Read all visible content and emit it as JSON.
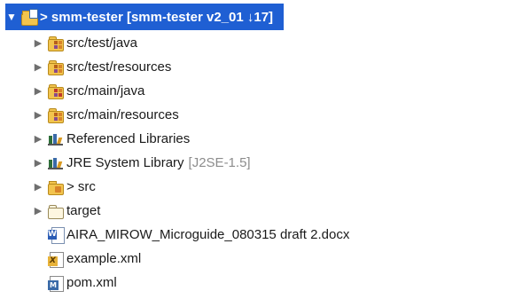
{
  "tree": {
    "root": {
      "twisty": "▼",
      "label": "> smm-tester [smm-tester v2_01 ↓17]",
      "icon": "java-project-icon"
    },
    "items": [
      {
        "twisty": "▶",
        "label": "src/test/java",
        "icon": "package-folder-icon"
      },
      {
        "twisty": "▶",
        "label": "src/test/resources",
        "icon": "package-folder-icon"
      },
      {
        "twisty": "▶",
        "label": "src/main/java",
        "icon": "package-folder-warning-icon"
      },
      {
        "twisty": "▶",
        "label": "src/main/resources",
        "icon": "package-folder-icon"
      },
      {
        "twisty": "▶",
        "label": "Referenced Libraries",
        "icon": "library-icon"
      },
      {
        "twisty": "▶",
        "label": "JRE System Library",
        "suffix": "[J2SE-1.5]",
        "icon": "library-icon"
      },
      {
        "twisty": "▶",
        "label": "> src",
        "icon": "source-folder-icon"
      },
      {
        "twisty": "▶",
        "label": "target",
        "icon": "folder-icon"
      },
      {
        "label": "AIRA_MIROW_Microguide_080315 draft 2.docx",
        "icon": "word-document-icon"
      },
      {
        "label": "example.xml",
        "icon": "xml-file-icon"
      },
      {
        "label": "pom.xml",
        "icon": "maven-pom-icon"
      }
    ]
  },
  "colors": {
    "selection": "#1f5fd3",
    "dim_text": "#8c8c8c"
  }
}
